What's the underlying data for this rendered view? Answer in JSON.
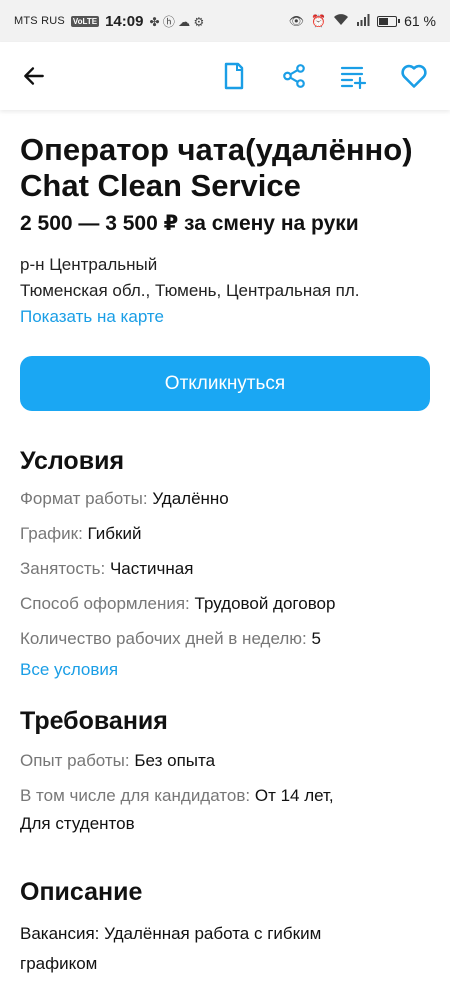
{
  "status": {
    "carrier": "MTS RUS",
    "volte": "VoLTE",
    "time": "14:09",
    "battery": "61 %",
    "battery_level": 0.61
  },
  "appbar": {
    "icons": [
      "back-arrow-icon",
      "bookmark-icon",
      "share-icon",
      "playlist-add-icon",
      "heart-icon"
    ],
    "accent": "#1a9ee6"
  },
  "vacancy": {
    "title": "Оператор чата(удалённо) Chat Clean Service",
    "salary": "2 500 — 3 500 ₽ за смену на руки",
    "district": "р-н Центральный",
    "address": "Тюменская обл., Тюмень, Центральная пл.",
    "map_link": "Показать на карте",
    "respond_button": "Откликнуться"
  },
  "conditions": {
    "heading": "Условия",
    "rows": [
      {
        "key": "Формат работы:",
        "value": "Удалённо"
      },
      {
        "key": "График:",
        "value": "Гибкий"
      },
      {
        "key": "Занятость:",
        "value": "Частичная"
      },
      {
        "key": "Способ оформления:",
        "value": "Трудовой договор"
      },
      {
        "key": "Количество рабочих дней в неделю:",
        "value": "5"
      }
    ],
    "all_link": "Все условия"
  },
  "requirements": {
    "heading": "Требования",
    "rows": [
      {
        "key": "Опыт работы:",
        "value": "Без опыта"
      },
      {
        "key": "В том числе для кандидатов:",
        "value": "От 14 лет,"
      }
    ],
    "extra": "Для студентов"
  },
  "description": {
    "heading": "Описание",
    "line1": "Вакансия: Удалённая работа с гибким",
    "line2": "графиком"
  }
}
